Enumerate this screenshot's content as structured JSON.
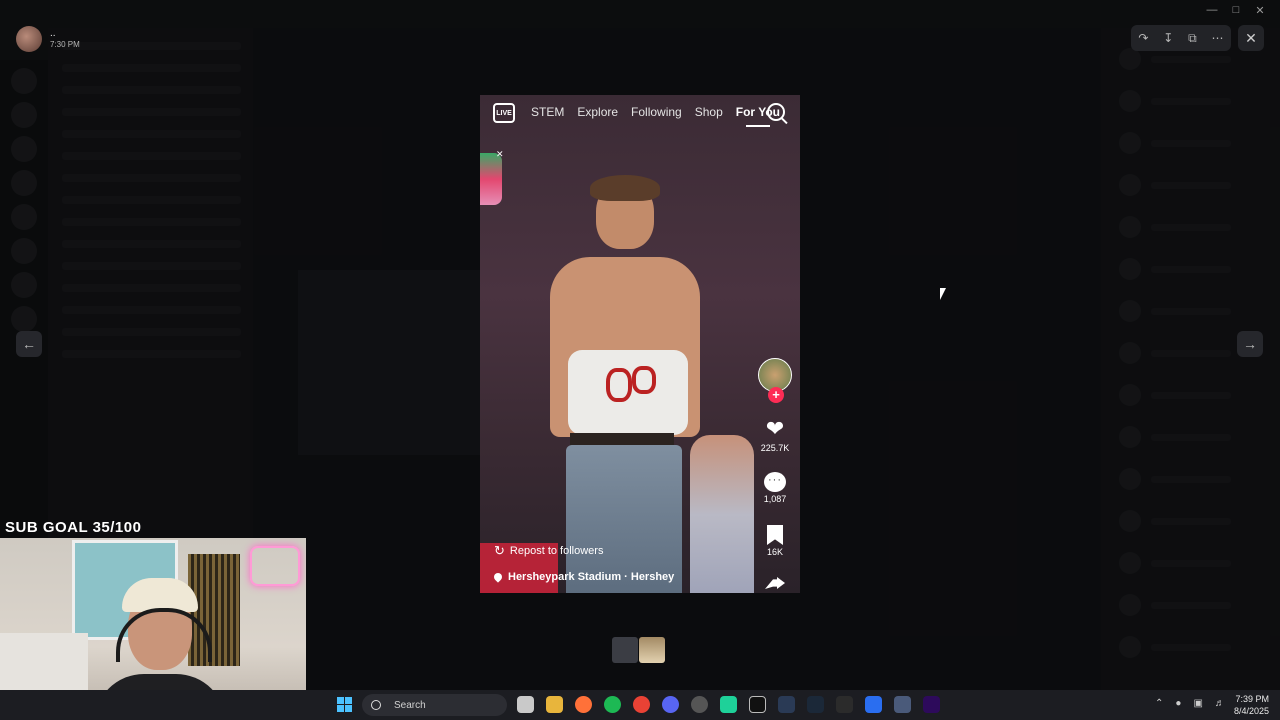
{
  "viewer": {
    "uploader_name": "..",
    "upload_time": "7:30 PM"
  },
  "tiktok": {
    "tabs": [
      {
        "label": "STEM"
      },
      {
        "label": "Explore"
      },
      {
        "label": "Following"
      },
      {
        "label": "Shop"
      },
      {
        "label": "For You"
      }
    ],
    "live_label": "LIVE",
    "like_count": "225.7K",
    "comment_count": "1,087",
    "save_count": "16K",
    "repost_label": "Repost to followers",
    "location_label": "Hersheypark Stadium · Hershey"
  },
  "stream": {
    "sub_goal": "SUB GOAL 35/100"
  },
  "taskbar": {
    "search_label": "Search",
    "time": "7:39 PM",
    "date": "8/4/2025"
  },
  "colors": {
    "like_accent": "#fe2c55",
    "windows_accent": "#4cc2ff"
  }
}
